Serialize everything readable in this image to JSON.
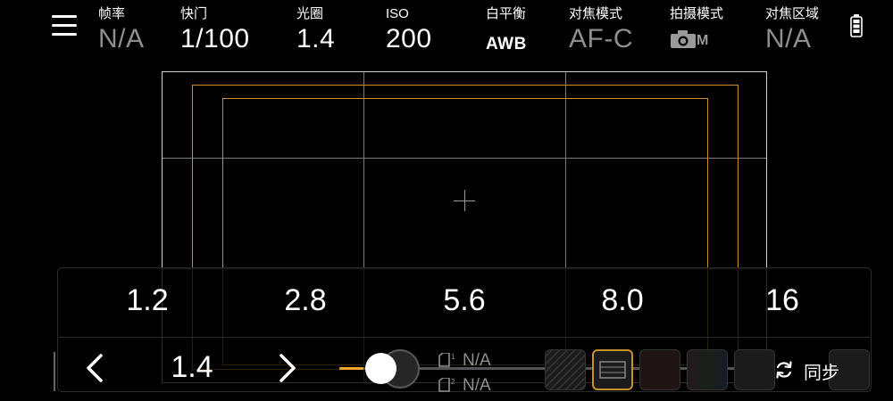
{
  "top_bar": {
    "params": [
      {
        "label": "帧率",
        "value": "N/A"
      },
      {
        "label": "快门",
        "value": "1/100"
      },
      {
        "label": "光圈",
        "value": "1.4"
      },
      {
        "label": "ISO",
        "value": "200"
      },
      {
        "label": "白平衡",
        "value": "AWB"
      },
      {
        "label": "对焦模式",
        "value": "AF-C"
      },
      {
        "label": "拍摄模式",
        "value": "M"
      },
      {
        "label": "对焦区域",
        "value": "N/A"
      }
    ],
    "icons": {
      "menu": "menu-icon",
      "camera_mode": "camera-icon",
      "battery": "battery-icon"
    }
  },
  "aperture_panel": {
    "scale": [
      "1.2",
      "2.8",
      "5.6",
      "8.0",
      "16"
    ],
    "current_value": "1.4",
    "slider_position_fraction": 0.06,
    "prev_icon": "chevron-left-icon",
    "next_icon": "chevron-right-icon"
  },
  "card_slots": [
    {
      "slot": "1",
      "value": "N/A"
    },
    {
      "slot": "2",
      "value": "N/A"
    }
  ],
  "sync": {
    "label": "同步",
    "icon": "sync-icon"
  },
  "colors": {
    "background": "#000000",
    "accent": "#f5a623",
    "frame_line": "#c9912a",
    "dim_text": "#8e8e8e",
    "selected_tile_border": "#c9912a"
  }
}
